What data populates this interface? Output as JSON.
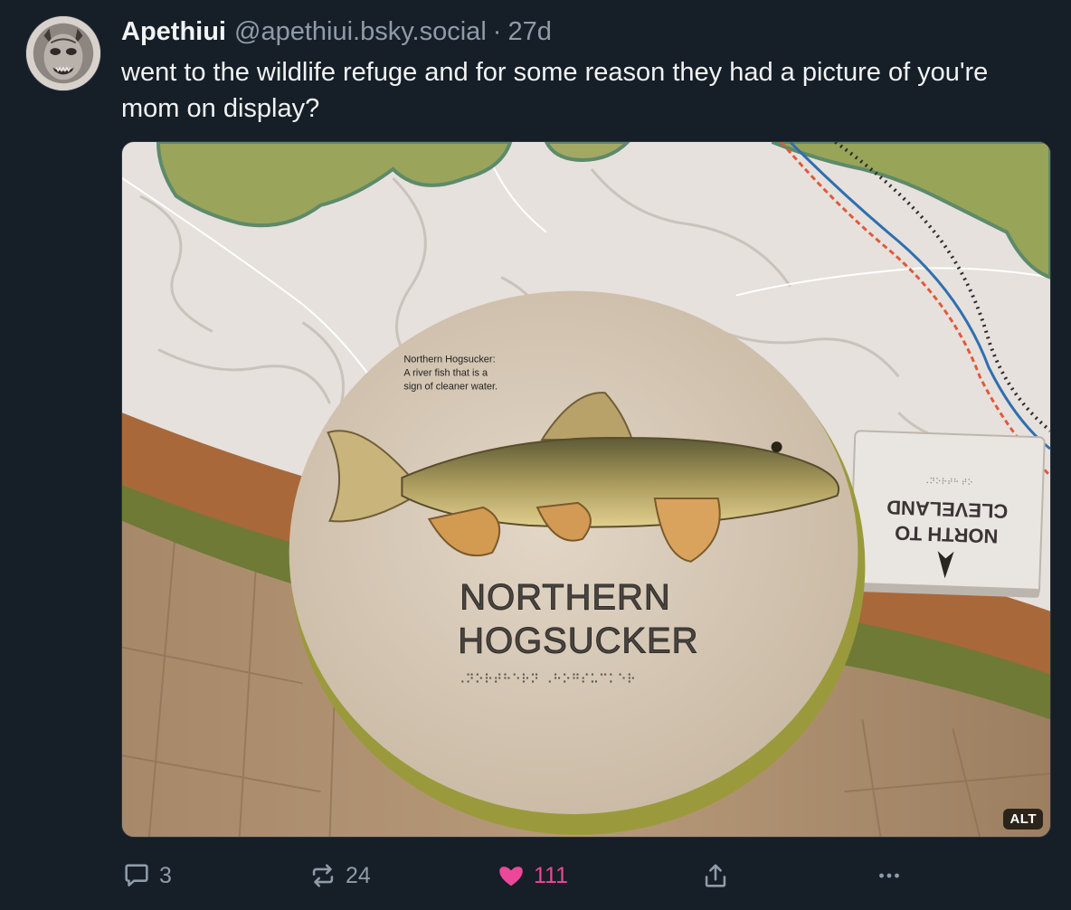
{
  "author": {
    "display_name": "Apethiui",
    "handle": "@apethiui.bsky.social",
    "separator": "·",
    "timestamp": "27d",
    "avatar_icon": "demon-mask-avatar"
  },
  "post": {
    "text": "went to the wildlife refuge and for some reason they had a picture of you're mom on display?"
  },
  "image": {
    "alt_badge": "ALT",
    "sign_caption_line1": "Northern Hogsucker:",
    "sign_caption_line2": "A river fish that is a",
    "sign_caption_line3": "sign of cleaner water.",
    "sign_title_line1": "NORTHERN",
    "sign_title_line2": "HOGSUCKER",
    "side_sign_line1": "NORTH TO",
    "side_sign_line2": "CLEVELAND"
  },
  "actions": {
    "reply_count": "3",
    "repost_count": "24",
    "like_count": "111",
    "like_color": "#ec4899",
    "reply_icon": "speech-bubble-icon",
    "repost_icon": "repost-arrows-icon",
    "like_icon": "heart-icon",
    "share_icon": "share-upload-icon",
    "more_icon": "ellipsis-icon"
  }
}
